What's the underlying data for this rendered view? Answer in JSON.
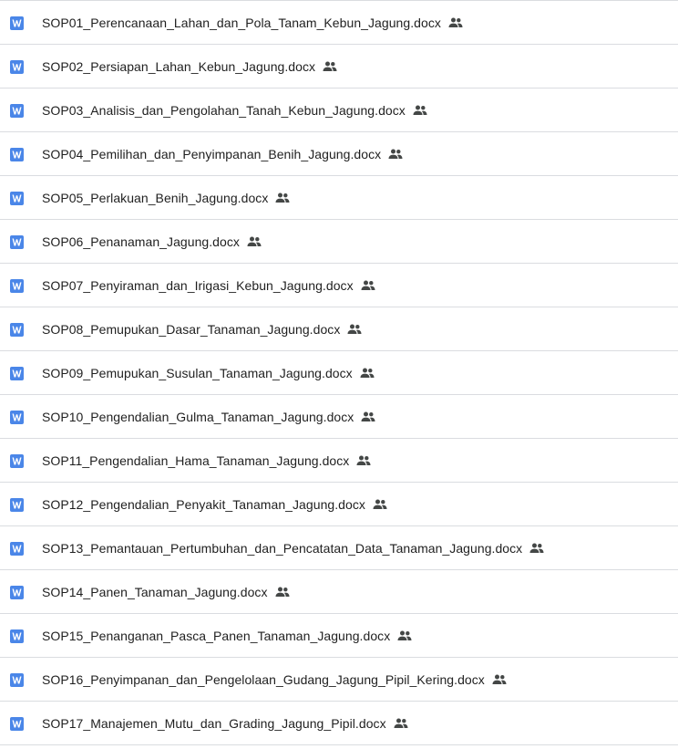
{
  "files": [
    {
      "name": "SOP01_Perencanaan_Lahan_dan_Pola_Tanam_Kebun_Jagung.docx",
      "icon": "word-doc-icon",
      "shared": true
    },
    {
      "name": "SOP02_Persiapan_Lahan_Kebun_Jagung.docx",
      "icon": "word-doc-icon",
      "shared": true
    },
    {
      "name": "SOP03_Analisis_dan_Pengolahan_Tanah_Kebun_Jagung.docx",
      "icon": "word-doc-icon",
      "shared": true
    },
    {
      "name": "SOP04_Pemilihan_dan_Penyimpanan_Benih_Jagung.docx",
      "icon": "word-doc-icon",
      "shared": true
    },
    {
      "name": "SOP05_Perlakuan_Benih_Jagung.docx",
      "icon": "word-doc-icon",
      "shared": true
    },
    {
      "name": "SOP06_Penanaman_Jagung.docx",
      "icon": "word-doc-icon",
      "shared": true
    },
    {
      "name": "SOP07_Penyiraman_dan_Irigasi_Kebun_Jagung.docx",
      "icon": "word-doc-icon",
      "shared": true
    },
    {
      "name": "SOP08_Pemupukan_Dasar_Tanaman_Jagung.docx",
      "icon": "word-doc-icon",
      "shared": true
    },
    {
      "name": "SOP09_Pemupukan_Susulan_Tanaman_Jagung.docx",
      "icon": "word-doc-icon",
      "shared": true
    },
    {
      "name": "SOP10_Pengendalian_Gulma_Tanaman_Jagung.docx",
      "icon": "word-doc-icon",
      "shared": true
    },
    {
      "name": "SOP11_Pengendalian_Hama_Tanaman_Jagung.docx",
      "icon": "word-doc-icon",
      "shared": true
    },
    {
      "name": "SOP12_Pengendalian_Penyakit_Tanaman_Jagung.docx",
      "icon": "word-doc-icon",
      "shared": true
    },
    {
      "name": "SOP13_Pemantauan_Pertumbuhan_dan_Pencatatan_Data_Tanaman_Jagung.docx",
      "icon": "word-doc-icon",
      "shared": true
    },
    {
      "name": "SOP14_Panen_Tanaman_Jagung.docx",
      "icon": "word-doc-icon",
      "shared": true
    },
    {
      "name": "SOP15_Penanganan_Pasca_Panen_Tanaman_Jagung.docx",
      "icon": "word-doc-icon",
      "shared": true
    },
    {
      "name": "SOP16_Penyimpanan_dan_Pengelolaan_Gudang_Jagung_Pipil_Kering.docx",
      "icon": "word-doc-icon",
      "shared": true
    },
    {
      "name": "SOP17_Manajemen_Mutu_dan_Grading_Jagung_Pipil.docx",
      "icon": "word-doc-icon",
      "shared": true
    }
  ],
  "colors": {
    "word_icon": "#4a86e8",
    "divider": "#dadce0",
    "text": "#1f1f1f",
    "shared_icon": "#444746"
  }
}
